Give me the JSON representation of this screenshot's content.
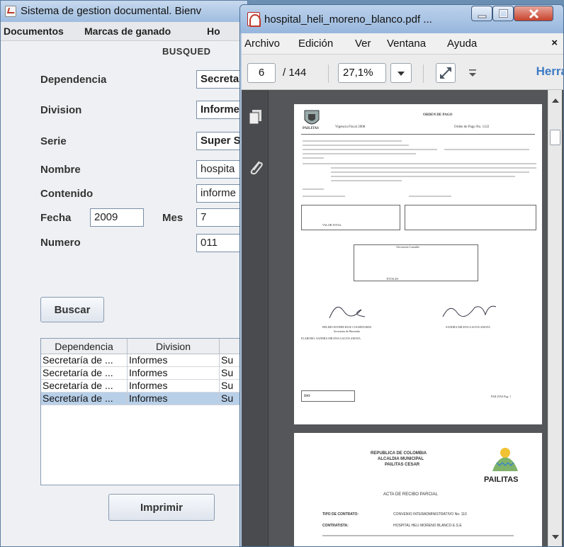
{
  "java_app": {
    "title": "Sistema de gestion documental. Bienv",
    "menu": [
      "Documentos",
      "Marcas de ganado",
      "Ho"
    ],
    "heading": "BUSQUED",
    "form": {
      "dependencia_label": "Dependencia",
      "dependencia_value": "Secreta",
      "division_label": "Division",
      "division_value": "Informe",
      "serie_label": "Serie",
      "serie_value": "Super S",
      "nombre_label": "Nombre",
      "nombre_value": "hospita",
      "contenido_label": "Contenido",
      "contenido_value": "informe",
      "fecha_label": "Fecha",
      "fecha_value": "2009",
      "mes_label": "Mes",
      "mes_value": "7",
      "numero_label": "Numero",
      "numero_value": "011"
    },
    "buscar_label": "Buscar",
    "imprimir_label": "Imprimir",
    "table": {
      "headers": [
        "Dependencia",
        "Division",
        ""
      ],
      "rows": [
        [
          "Secretaría de ...",
          "Informes",
          "Su"
        ],
        [
          "Secretaría de ...",
          "Informes",
          "Su"
        ],
        [
          "Secretaría de ...",
          "Informes",
          "Su"
        ],
        [
          "Secretaría de ...",
          "Informes",
          "Su"
        ]
      ],
      "selected_row": 3
    }
  },
  "pdf_viewer": {
    "title": "hospital_heli_moreno_blanco.pdf ...",
    "menu": [
      "Archivo",
      "Edición",
      "Ver",
      "Ventana",
      "Ayuda"
    ],
    "close_tab_glyph": "×",
    "page_current": "6",
    "page_total": "/ 144",
    "zoom": "27,1%",
    "tools_label": "Herra",
    "page1": {
      "entity": "PAILITAS",
      "heading": "ORDEN DE PAGO",
      "vigencia": "Vigencia Fiscal  2008",
      "orden": "Orden de Pago No.   1122",
      "valor_total_label": "VALOR TOTAL",
      "afectacion_label": "Afectación Contable",
      "totales_label": "TOTALES",
      "signer_left": "BELMIS ESTHER RUIZ COLMENARES",
      "signer_left_role": "Secretaria de Hacienda",
      "signer_right": "SANDRA MILENA GALVIS AMAYA",
      "elaboro": "ELABORO: SANDRA MILENA GALVIS AMAYA",
      "footer_code": "ISO",
      "footer_right": "PAILITAS   Pag. 1"
    },
    "page2": {
      "line1": "REPUBLICA DE COLOMBIA",
      "line2": "ALCALDIA MUNICIPAL",
      "line3": "PAILITAS CESAR",
      "logo_text": "PAILITAS",
      "doc_title": "ACTA DE RECIBO PARCIAL",
      "row1_label": "TIPO DE CONTRATO:",
      "row1_value": "CONVENIO INTERADMINISTRATIVO No. 110",
      "row2_label": "CONTRATISTA:",
      "row2_value": "HOSPITAL HELI MORENO BLANCO E.S.E"
    }
  },
  "colors": {
    "accent": "#3e7bc4",
    "selected_row": "#b8cfe8",
    "pdf_background": "#555659"
  },
  "icons": [
    "java-app-icon",
    "pdf-app-icon",
    "thumbnails-icon",
    "attachment-icon",
    "fullscreen-icon"
  ]
}
